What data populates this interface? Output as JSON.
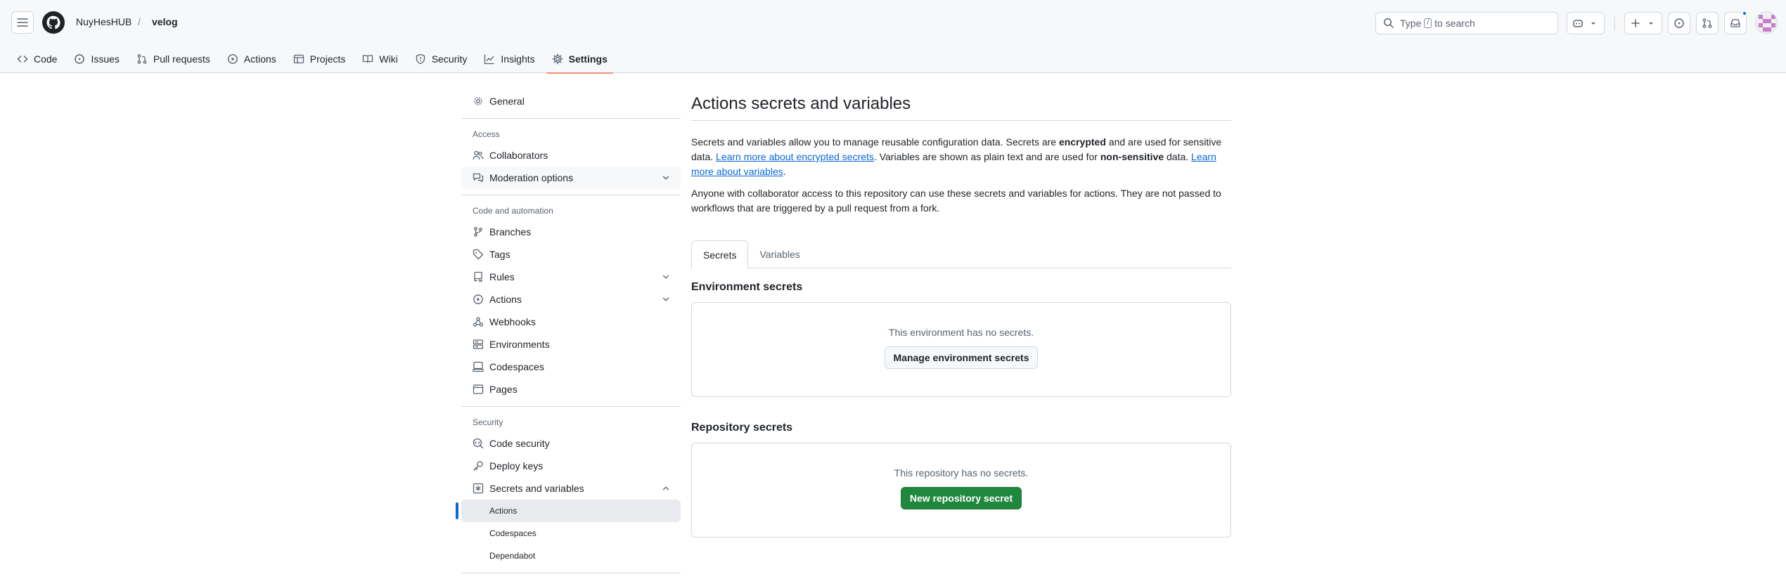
{
  "header": {
    "owner": "NuyHesHUB",
    "separator": "/",
    "repo": "velog",
    "search_prefix": "Type",
    "search_key": "/",
    "search_suffix": "to search"
  },
  "repo_nav": [
    {
      "label": "Code",
      "icon": "code-icon"
    },
    {
      "label": "Issues",
      "icon": "issue-icon"
    },
    {
      "label": "Pull requests",
      "icon": "pull-request-icon"
    },
    {
      "label": "Actions",
      "icon": "play-icon"
    },
    {
      "label": "Projects",
      "icon": "table-icon"
    },
    {
      "label": "Wiki",
      "icon": "book-icon"
    },
    {
      "label": "Security",
      "icon": "shield-icon"
    },
    {
      "label": "Insights",
      "icon": "graph-icon"
    },
    {
      "label": "Settings",
      "icon": "gear-icon",
      "active": true
    }
  ],
  "sidebar": {
    "general": "General",
    "access_heading": "Access",
    "collaborators": "Collaborators",
    "moderation": "Moderation options",
    "code_heading": "Code and automation",
    "branches": "Branches",
    "tags": "Tags",
    "rules": "Rules",
    "actions": "Actions",
    "webhooks": "Webhooks",
    "environments": "Environments",
    "codespaces": "Codespaces",
    "pages": "Pages",
    "security_heading": "Security",
    "code_security": "Code security",
    "deploy_keys": "Deploy keys",
    "secrets": "Secrets and variables",
    "sub_actions": "Actions",
    "sub_codespaces": "Codespaces",
    "sub_dependabot": "Dependabot"
  },
  "main": {
    "title": "Actions secrets and variables",
    "desc_1": "Secrets and variables allow you to manage reusable configuration data. Secrets are ",
    "desc_encrypted": "encrypted",
    "desc_2": " and are used for sensitive data. ",
    "link_secrets": "Learn more about encrypted secrets",
    "desc_3": ". Variables are shown as plain text and are used for ",
    "desc_nonsensitive": "non-sensitive",
    "desc_4": " data. ",
    "link_variables": "Learn more about variables",
    "desc_5": ".",
    "desc_access": "Anyone with collaborator access to this repository can use these secrets and variables for actions. They are not passed to workflows that are triggered by a pull request from a fork.",
    "tab_secrets": "Secrets",
    "tab_variables": "Variables",
    "env_title": "Environment secrets",
    "env_empty": "This environment has no secrets.",
    "env_button": "Manage environment secrets",
    "repo_title": "Repository secrets",
    "repo_empty": "This repository has no secrets.",
    "repo_button": "New repository secret"
  },
  "colors": {
    "accent": "#0969da",
    "primary_button": "#1f883d",
    "tab_underline": "#fd8c73"
  }
}
